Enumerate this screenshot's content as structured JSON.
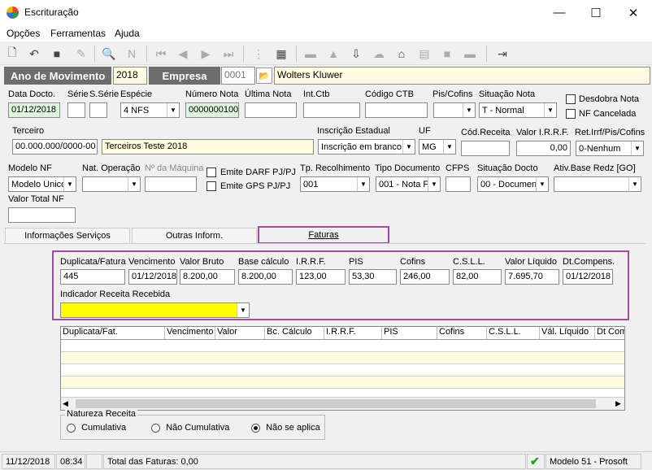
{
  "window": {
    "title": "Escrituração",
    "minimize": "—",
    "maximize": "☐",
    "close": "✕"
  },
  "menu": [
    "Opções",
    "Ferramentas",
    "Ajuda"
  ],
  "header": {
    "ano_label": "Ano de Movimento",
    "ano_value": "2018",
    "empresa_label": "Empresa",
    "empresa_code": "0001",
    "empresa_name": "Wolters Kluwer"
  },
  "row1": {
    "data_docto": {
      "label": "Data Docto.",
      "value": "01/12/2018"
    },
    "serie": {
      "label": "Série",
      "value": ""
    },
    "sserie": {
      "label": "S.Série",
      "value": ""
    },
    "especie": {
      "label": "Espécie",
      "value": "4 NFS"
    },
    "numero_nota": {
      "label": "Número Nota",
      "value": "0000000100"
    },
    "ultima_nota": {
      "label": "Última Nota",
      "value": ""
    },
    "int_ctb": {
      "label": "Int.Ctb",
      "value": ""
    },
    "codigo_ctb": {
      "label": "Código CTB",
      "value": ""
    },
    "pis_cofins": {
      "label": "Pis/Cofins",
      "value": ""
    },
    "situacao_nota": {
      "label": "Situação Nota",
      "value": "T - Normal"
    },
    "desdobra_nota": "Desdobra Nota",
    "nf_cancelada": "NF Cancelada"
  },
  "row2": {
    "terceiro": {
      "label": "Terceiro",
      "code": "00.000.000/0000-00",
      "name": "Terceiros Teste 2018"
    },
    "inscricao_estadual": {
      "label": "Inscrição Estadual",
      "value": "Inscrição em branco"
    },
    "uf": {
      "label": "UF",
      "value": "MG"
    },
    "cod_receita": {
      "label": "Cód.Receita",
      "value": ""
    },
    "valor_irrf": {
      "label": "Valor I.R.R.F.",
      "value": "0,00"
    },
    "ret_irrf": {
      "label": "Ret.Irrf/Pis/Cofins",
      "value": "0-Nenhum"
    }
  },
  "row3": {
    "modelo_nf": {
      "label": "Modelo NF",
      "value": "Modelo Único"
    },
    "nat_operacao": {
      "label": "Nat. Operação",
      "value": ""
    },
    "no_maquina": {
      "label": "Nº da Máquina",
      "value": ""
    },
    "emite_darf": "Emite DARF PJ/PJ",
    "emite_gps": "Emite GPS PJ/PJ",
    "tp_recolhimento": {
      "label": "Tp. Recolhimento",
      "value": "001"
    },
    "tipo_documento": {
      "label": "Tipo Documento",
      "value": "001 - Nota F"
    },
    "cfps": {
      "label": "CFPS",
      "value": ""
    },
    "situacao_docto": {
      "label": "Situação Docto",
      "value": "00 - Documen"
    },
    "ativ_base": {
      "label": "Ativ.Base Redz [GO]",
      "value": ""
    },
    "valor_total_nf": {
      "label": "Valor Total NF",
      "value": ""
    }
  },
  "tabs": [
    "Informações Serviços",
    "Outras Inform.",
    "Faturas"
  ],
  "faturas": {
    "duplicata": {
      "label": "Duplicata/Fatura",
      "value": "445"
    },
    "vencimento": {
      "label": "Vencimento",
      "value": "01/12/2018"
    },
    "valor_bruto": {
      "label": "Valor Bruto",
      "value": "8.200,00"
    },
    "base_calculo": {
      "label": "Base cálculo",
      "value": "8.200,00"
    },
    "irrf": {
      "label": "I.R.R.F.",
      "value": "123,00"
    },
    "pis": {
      "label": "PIS",
      "value": "53,30"
    },
    "cofins": {
      "label": "Cofins",
      "value": "246,00"
    },
    "csll": {
      "label": "C.S.L.L.",
      "value": "82,00"
    },
    "valor_liquido": {
      "label": "Valor Líquido",
      "value": "7.695,70"
    },
    "dt_compens": {
      "label": "Dt.Compens.",
      "value": "01/12/2018"
    },
    "indicador": {
      "label": "Indicador Receita Recebida",
      "value": ""
    }
  },
  "grid": {
    "columns": [
      "Duplicata/Fat.",
      "Vencimento",
      "Valor",
      "Bc. Cálculo",
      "I.R.R.F.",
      "PIS",
      "Cofins",
      "C.S.L.L.",
      "Vál. Líquido",
      "Dt Com"
    ]
  },
  "natureza": {
    "title": "Natureza Receita",
    "options": [
      "Cumulativa",
      "Não Cumulativa",
      "Não se aplica"
    ],
    "selected": 2
  },
  "status": {
    "date": "11/12/2018",
    "time": "08:34",
    "total": "Total das Faturas: 0,00",
    "modelo": "Modelo 51 - Prosoft"
  },
  "colors": {
    "band": "#6d6d6d",
    "highlight": "#a0499e",
    "yellow": "#ffff00",
    "green_field": "#dff5df",
    "row_alt": "#fffde0"
  }
}
